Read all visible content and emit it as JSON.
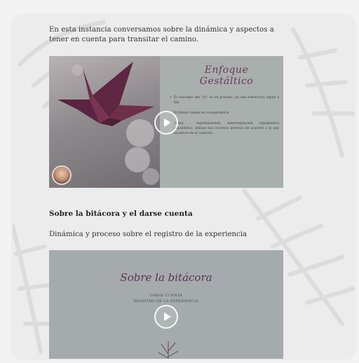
{
  "intro": {
    "text": "En esta instancia conversamos sobre la dinámica  y aspectos a tener en cuenta para transitar el camino."
  },
  "video1": {
    "title": "Enfoque Gestáltico",
    "bullets": [
      "El concepto del \"yo\" es un proceso, no una estructura rígida y fija",
      "El Darse cuenta en la experiencia",
      "Salud - espontaneidad, autorregulación organísmica (equilibrio), utilizar mis recursos internos de acuerdo a lo que acontece en el contexto"
    ]
  },
  "section": {
    "title": "Sobre la bitácora y el darse cuenta",
    "description": "Dinámica y proceso sobre el registro de la experiencia"
  },
  "video2": {
    "title": "Sobre la bitácora",
    "sub1": "DARSE CUENTA",
    "sub2": "REGISTRO DE LA EXPERIENCIA"
  },
  "colors": {
    "page_bg": "#f3f3f3",
    "card_bg": "#ececec",
    "accent_title": "#6a3a5c",
    "video_panel": "#a9afad"
  },
  "icons": {
    "play": "play-icon",
    "avatar": "avatar",
    "leaves": "leaf-pattern"
  }
}
